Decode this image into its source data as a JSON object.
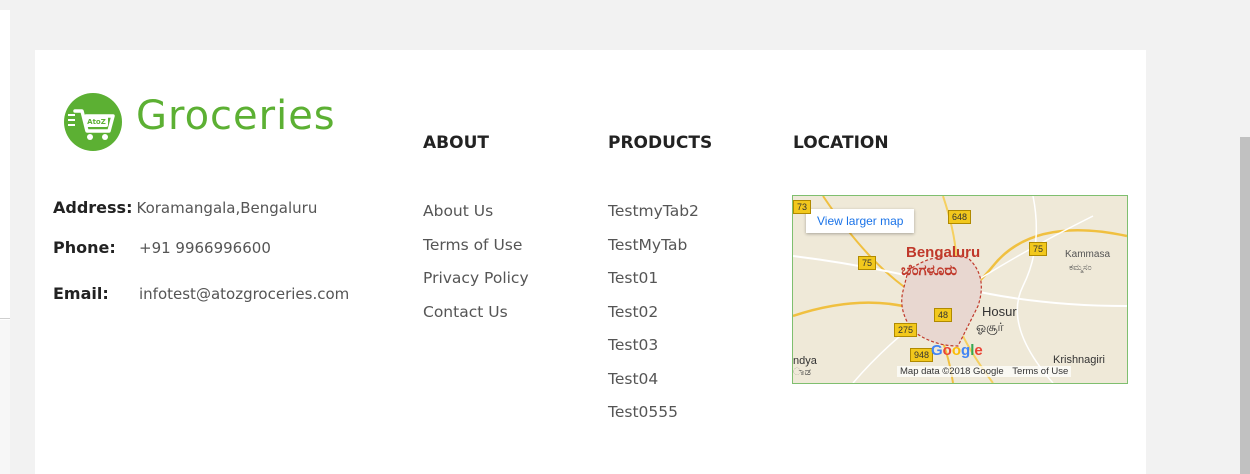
{
  "brand": {
    "name": "Groceries",
    "badge": "AtoZ",
    "color": "#5cb033"
  },
  "contact": {
    "address_label": "Address:",
    "address": "Koramangala,Bengaluru",
    "phone_label": "Phone:",
    "phone": "+91 9966996600",
    "email_label": "Email:",
    "email": "infotest@atozgroceries.com"
  },
  "about": {
    "heading": "ABOUT",
    "links": [
      "About Us",
      "Terms of Use",
      "Privacy Policy",
      "Contact Us"
    ]
  },
  "products": {
    "heading": "PRODUCTS",
    "links": [
      "TestmyTab2",
      "TestMyTab",
      "Test01",
      "Test02",
      "Test03",
      "Test04",
      "Test0555"
    ]
  },
  "location": {
    "heading": "LOCATION",
    "map": {
      "view_larger": "View larger map",
      "city_en": "Bengaluru",
      "city_kn": "ಬೆಂಗಳೂರು",
      "hosur": "Hosur",
      "hosur_ta": "ஓசூர்",
      "kammasa": "Kammasa",
      "kammasa_kn": "ಕಮ್ಮಸಂ",
      "krishnagiri": "Krishnagiri",
      "mandya": "ndya",
      "mandya_kn": "ಾಡ",
      "highways": [
        "73",
        "648",
        "75",
        "75",
        "48",
        "275",
        "948"
      ],
      "google": "Google",
      "map_data": "Map data ©2018 Google",
      "terms": "Terms of Use"
    }
  }
}
